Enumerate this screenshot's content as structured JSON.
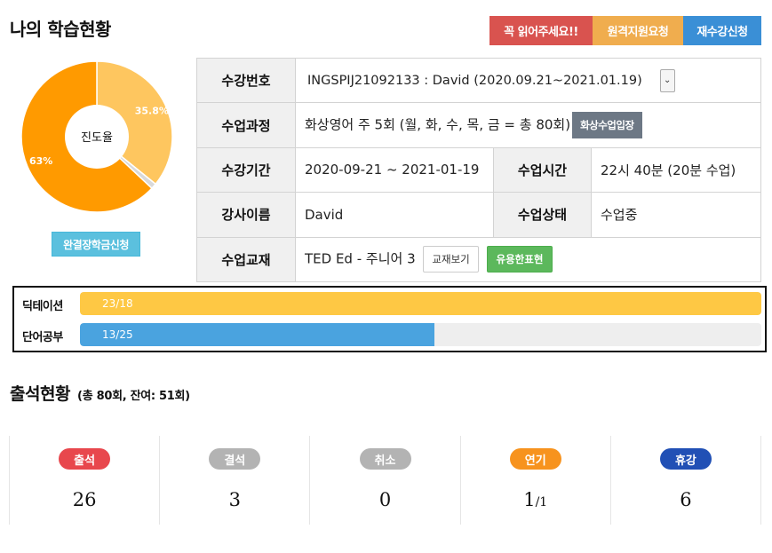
{
  "header": {
    "title": "나의 학습현황",
    "buttons": {
      "must_read": "꼭 읽어주세요!!",
      "remote_support": "원격지원요청",
      "re_register": "재수강신청"
    }
  },
  "progress_chart": {
    "center_label": "진도율",
    "slices": [
      {
        "label": "35.8%",
        "value": 35.8,
        "color": "#fec65f"
      },
      {
        "label": "",
        "value": 1.2,
        "color": "#d9d9d9"
      },
      {
        "label": "63%",
        "value": 63.0,
        "color": "#ff9a00"
      }
    ]
  },
  "scholarship_button": "완결장학금신청",
  "course_info": {
    "course_number_label": "수강번호",
    "course_number_value": "INGSPIJ21092133 : David (2020.09.21~2021.01.19)",
    "class_course_label": "수업과정",
    "class_course_value": "화상영어 주 5회 (월, 화, 수, 목, 금 = 총 80회)",
    "enter_class_button": "화상수업입장",
    "period_label": "수강기간",
    "period_value": "2020-09-21 ~ 2021-01-19",
    "class_time_label": "수업시간",
    "class_time_value": "22시 40분 (20분 수업)",
    "teacher_label": "강사이름",
    "teacher_value": "David",
    "status_label": "수업상태",
    "status_value": "수업중",
    "textbook_label": "수업교재",
    "textbook_value": "TED Ed - 주니어 3",
    "view_textbook_button": "교재보기",
    "useful_expressions_button": "유용한표현"
  },
  "study_progress": [
    {
      "label": "딕테이션",
      "text": "23/18",
      "fraction": 1.0,
      "color": "#fec844"
    },
    {
      "label": "단어공부",
      "text": "13/25",
      "fraction": 0.52,
      "color": "#4aa3df"
    }
  ],
  "attendance": {
    "title": "출석현황",
    "subtitle": "(총 80회, 잔여: 51회)",
    "items": [
      {
        "label": "출석",
        "count": "26",
        "suffix": "",
        "color": "#e8474d"
      },
      {
        "label": "결석",
        "count": "3",
        "suffix": "",
        "color": "#b3b3b3"
      },
      {
        "label": "취소",
        "count": "0",
        "suffix": "",
        "color": "#b3b3b3"
      },
      {
        "label": "연기",
        "count": "1",
        "suffix": "/1",
        "color": "#f7931e"
      },
      {
        "label": "휴강",
        "count": "6",
        "suffix": "",
        "color": "#2150b5"
      }
    ]
  }
}
